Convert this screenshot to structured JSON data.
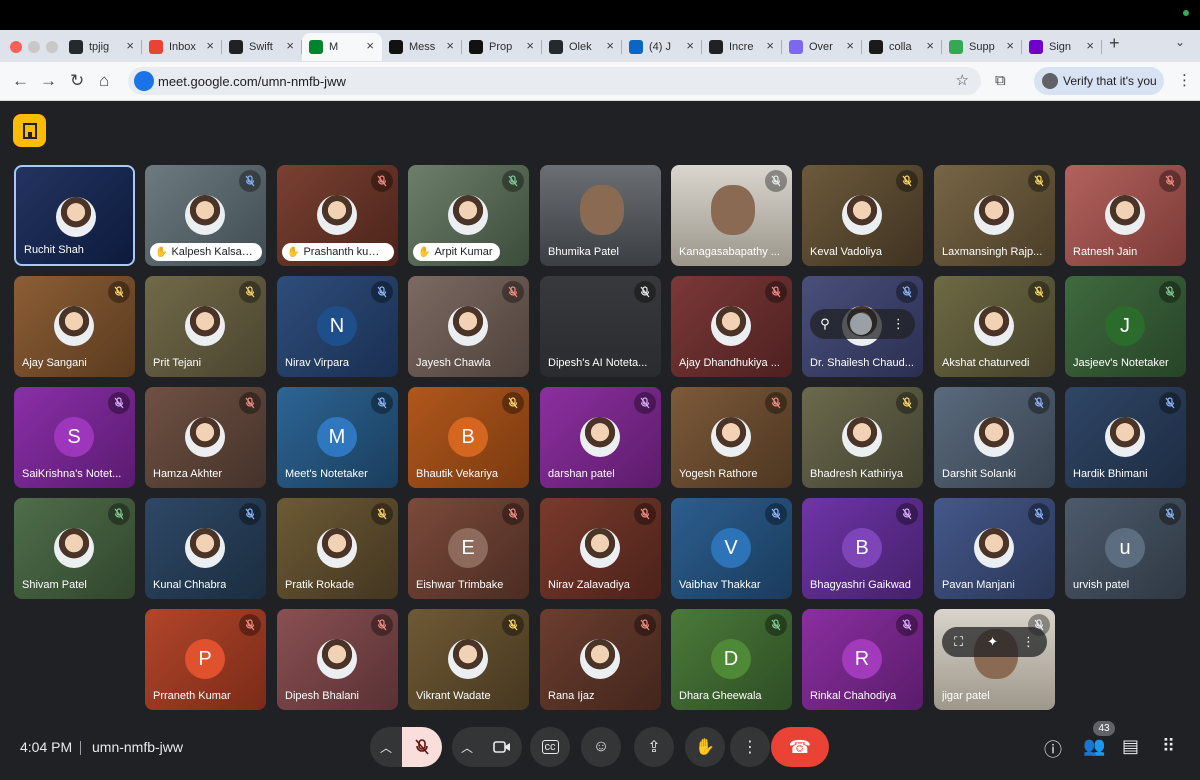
{
  "browser": {
    "tabs": [
      {
        "title": "tpjig",
        "icon": "github-icon",
        "color": "#24292f"
      },
      {
        "title": "Inbox",
        "icon": "gmail-icon",
        "color": "#ea4335"
      },
      {
        "title": "Swift",
        "icon": "sparkle-icon",
        "color": "#202124"
      },
      {
        "title": "M",
        "icon": "meet-icon",
        "color": "#00832d",
        "active": true
      },
      {
        "title": "Mess",
        "icon": "upwork-icon",
        "color": "#111"
      },
      {
        "title": "Prop",
        "icon": "upwork-icon",
        "color": "#111"
      },
      {
        "title": "Olek",
        "icon": "github-icon",
        "color": "#24292f"
      },
      {
        "title": "(4) J",
        "icon": "linkedin-icon",
        "color": "#0a66c2"
      },
      {
        "title": "Incre",
        "icon": "openai-icon",
        "color": "#202124"
      },
      {
        "title": "Over",
        "icon": "clickup-icon",
        "color": "#7b68ee"
      },
      {
        "title": "colla",
        "icon": "collab-icon",
        "color": "#1a1a1a"
      },
      {
        "title": "Supp",
        "icon": "shopify-icon",
        "color": "#34a853"
      },
      {
        "title": "Sign",
        "icon": "make-icon",
        "color": "#6d00cc"
      }
    ],
    "url": "meet.google.com/umn-nmfb-jww",
    "verify_label": "Verify that it's you"
  },
  "colors": {
    "mic_muted": "#ea4335",
    "mic_active": "#8ab4f8",
    "hangup": "#ea4335",
    "host_button": "#fbbc04"
  },
  "participants": [
    {
      "name": "Ruchit Shah",
      "bg": "linear-gradient(135deg,#23345f,#0d1a3d)",
      "avatar": "photo",
      "speaking": true
    },
    {
      "name": "Kalpesh Kalsariya",
      "bg": "linear-gradient(135deg,#6d7b81,#3f4c52)",
      "avatar": "photo",
      "hand": true,
      "mic": "muted-blue"
    },
    {
      "name": "Prashanth kuma...",
      "bg": "linear-gradient(135deg,#7a4033,#4b2319)",
      "avatar": "photo",
      "hand": true,
      "mic": "muted-red"
    },
    {
      "name": "Arpit Kumar",
      "bg": "linear-gradient(135deg,#6d7f6b,#3c4c3b)",
      "avatar": "photo",
      "hand": true,
      "mic": "muted-green"
    },
    {
      "name": "Bhumika Patel",
      "bg": "linear-gradient(#6b6f73,#3b3f44)",
      "video": true
    },
    {
      "name": "Kanagasabapathy ...",
      "bg": "linear-gradient(#d9d6cf,#9c968b)",
      "video": true,
      "mic": "muted-gray"
    },
    {
      "name": "Keval Vadoliya",
      "bg": "linear-gradient(135deg,#6c5a3b,#3f3221)",
      "avatar": "photo",
      "mic": "muted-amber"
    },
    {
      "name": "Laxmansingh Rajp...",
      "bg": "linear-gradient(135deg,#776545,#4a3d28)",
      "avatar": "photo",
      "mic": "muted-amber"
    },
    {
      "name": "Ratnesh Jain",
      "bg": "linear-gradient(135deg,#b3625e,#7a3a36)",
      "avatar": "photo",
      "mic": "muted-red"
    },
    {
      "name": "Ajay Sangani",
      "bg": "linear-gradient(135deg,#8c5e35,#5a3a1f)",
      "avatar": "photo",
      "mic": "muted-amber"
    },
    {
      "name": "Prit Tejani",
      "bg": "linear-gradient(135deg,#716a48,#4a4430)",
      "avatar": "photo",
      "mic": "muted-amber"
    },
    {
      "name": "Nirav Virpara",
      "bg": "linear-gradient(135deg,#2e4d7a,#1a2f52)",
      "avatar": "N",
      "avatar_color": "#1e4f8a",
      "mic": "muted-blue"
    },
    {
      "name": "Jayesh Chawla",
      "bg": "linear-gradient(135deg,#7c6a62,#4e413b)",
      "avatar": "photo",
      "mic": "muted-red"
    },
    {
      "name": "Dipesh's AI Noteta...",
      "bg": "linear-gradient(#38393c,#2a2b2e)",
      "avatar": "none",
      "mic": "muted-gray"
    },
    {
      "name": "Ajay Dhandhukiya ...",
      "bg": "linear-gradient(135deg,#7c3838,#4d2020)",
      "avatar": "photo",
      "mic": "muted-red"
    },
    {
      "name": "Dr. Shailesh Chaud...",
      "bg": "linear-gradient(135deg,#4a4f7b,#2b2f52)",
      "avatar": "photo",
      "mic": "muted-blue",
      "hover": true
    },
    {
      "name": "Akshat chaturvedi",
      "bg": "linear-gradient(135deg,#6e6a44,#44412a)",
      "avatar": "photo",
      "mic": "muted-amber"
    },
    {
      "name": "Jasjeev's Notetaker",
      "bg": "linear-gradient(135deg,#3f6a3f,#274427)",
      "avatar": "J",
      "avatar_color": "#2b6b2b",
      "mic": "muted-green"
    },
    {
      "name": "SaiKrishna's Notet...",
      "bg": "linear-gradient(135deg,#8a2fa8,#5a1b70)",
      "avatar": "S",
      "avatar_color": "#9c37bb",
      "mic": "muted-purple"
    },
    {
      "name": "Hamza Akhter",
      "bg": "linear-gradient(135deg,#6f5143,#45322a)",
      "avatar": "photo",
      "mic": "muted-red"
    },
    {
      "name": "Meet's Notetaker",
      "bg": "linear-gradient(135deg,#2d6595,#1a3d5c)",
      "avatar": "M",
      "avatar_color": "#2f78c0",
      "mic": "muted-blue"
    },
    {
      "name": "Bhautik Vekariya",
      "bg": "linear-gradient(135deg,#b0571c,#7a3a10)",
      "avatar": "B",
      "avatar_color": "#d4661f",
      "mic": "muted-amber"
    },
    {
      "name": "darshan patel",
      "bg": "linear-gradient(135deg,#8c2fa0,#5c1c6a)",
      "avatar": "photo",
      "mic": "muted-purple"
    },
    {
      "name": "Yogesh Rathore",
      "bg": "linear-gradient(135deg,#7d5a3a,#4d3620)",
      "avatar": "photo",
      "mic": "muted-red"
    },
    {
      "name": "Bhadresh Kathiriya",
      "bg": "linear-gradient(135deg,#6b6a4c,#414030)",
      "avatar": "photo",
      "mic": "muted-amber"
    },
    {
      "name": "Darshit Solanki",
      "bg": "linear-gradient(135deg,#5a6a7d,#37424f)",
      "avatar": "photo",
      "mic": "muted-blue"
    },
    {
      "name": "Hardik Bhimani",
      "bg": "linear-gradient(135deg,#2f4666,#1d2c42)",
      "avatar": "photo",
      "mic": "muted-blue"
    },
    {
      "name": "Shivam Patel",
      "bg": "linear-gradient(135deg,#4f6e4a,#31452d)",
      "avatar": "photo",
      "mic": "muted-green"
    },
    {
      "name": "Kunal Chhabra",
      "bg": "linear-gradient(135deg,#2e4866,#1b2d40)",
      "avatar": "photo",
      "mic": "muted-blue"
    },
    {
      "name": "Pratik Rokade",
      "bg": "linear-gradient(135deg,#6d5a35,#433620)",
      "avatar": "photo",
      "mic": "muted-amber"
    },
    {
      "name": "Eishwar Trimbake",
      "bg": "linear-gradient(135deg,#7b4a3a,#4b2c22)",
      "avatar": "E",
      "avatar_color": "#8d6a5c",
      "mic": "muted-red"
    },
    {
      "name": "Nirav Zalavadiya",
      "bg": "linear-gradient(135deg,#7a3a2c,#4b221a)",
      "avatar": "photo",
      "mic": "muted-red"
    },
    {
      "name": "Vaibhav Thakkar",
      "bg": "linear-gradient(135deg,#2c5e8f,#1a3b5c)",
      "avatar": "V",
      "avatar_color": "#2d73b8",
      "mic": "muted-blue"
    },
    {
      "name": "Bhagyashri Gaikwad",
      "bg": "linear-gradient(135deg,#6f35a8,#44206a)",
      "avatar": "B",
      "avatar_color": "#7e45b8",
      "mic": "muted-purple"
    },
    {
      "name": "Pavan Manjani",
      "bg": "linear-gradient(135deg,#44588a,#2a3657)",
      "avatar": "photo",
      "mic": "muted-blue"
    },
    {
      "name": "urvish patel",
      "bg": "linear-gradient(135deg,#4c5a6b,#2f3843)",
      "avatar": "u",
      "avatar_color": "#5b6d7e",
      "mic": "muted-blue"
    },
    {
      "name": "Prraneth Kumar",
      "bg": "linear-gradient(135deg,#b2452a,#7a2b18)",
      "avatar": "P",
      "avatar_color": "#e0512e",
      "mic": "muted-red"
    },
    {
      "name": "Dipesh Bhalani",
      "bg": "linear-gradient(135deg,#8a5052,#583134)",
      "avatar": "photo",
      "mic": "muted-red"
    },
    {
      "name": "Vikrant Wadate",
      "bg": "linear-gradient(135deg,#6f5a35,#463720)",
      "avatar": "photo",
      "mic": "muted-amber"
    },
    {
      "name": "Rana Ijaz",
      "bg": "linear-gradient(135deg,#6c3e2f,#42251c)",
      "avatar": "photo",
      "mic": "muted-red"
    },
    {
      "name": "Dhara Gheewala",
      "bg": "linear-gradient(135deg,#4a7a3a,#2e4d24)",
      "avatar": "D",
      "avatar_color": "#4e8a35",
      "mic": "muted-green"
    },
    {
      "name": "Rinkal Chahodiya",
      "bg": "linear-gradient(135deg,#8a2fa0,#5a1c6a)",
      "avatar": "R",
      "avatar_color": "#a13abb",
      "mic": "muted-purple"
    },
    {
      "name": "jigar patel",
      "bg": "linear-gradient(#d8d4cb,#9e978b)",
      "video": true,
      "mic": "muted-gray",
      "selfview": true
    }
  ],
  "bottom": {
    "time": "4:04 PM",
    "meeting_code": "umn-nmfb-jww",
    "people_count": "43"
  }
}
